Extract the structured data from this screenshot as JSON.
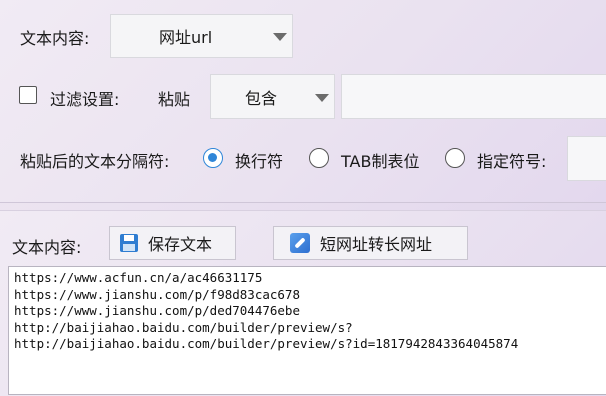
{
  "top": {
    "content_label": "文本内容:",
    "content_combo_value": "网址url",
    "filter_label": "过滤设置:",
    "paste_label": "粘贴",
    "filter_combo_value": "包含",
    "filter_text_value": "",
    "separator_label": "粘贴后的文本分隔符:",
    "radio_newline": "换行符",
    "radio_tab": "TAB制表位",
    "radio_custom": "指定符号:",
    "custom_symbol_value": ""
  },
  "bottom": {
    "content_label": "文本内容:",
    "save_button": "保存文本",
    "convert_button": "短网址转长网址",
    "lines": [
      "https://www.acfun.cn/a/ac46631175",
      "https://www.jianshu.com/p/f98d83cac678",
      "https://www.jianshu.com/p/ded704476ebe",
      "http://baijiahao.baidu.com/builder/preview/s?",
      "http://baijiahao.baidu.com/builder/preview/s?id=1817942843364045874"
    ]
  }
}
